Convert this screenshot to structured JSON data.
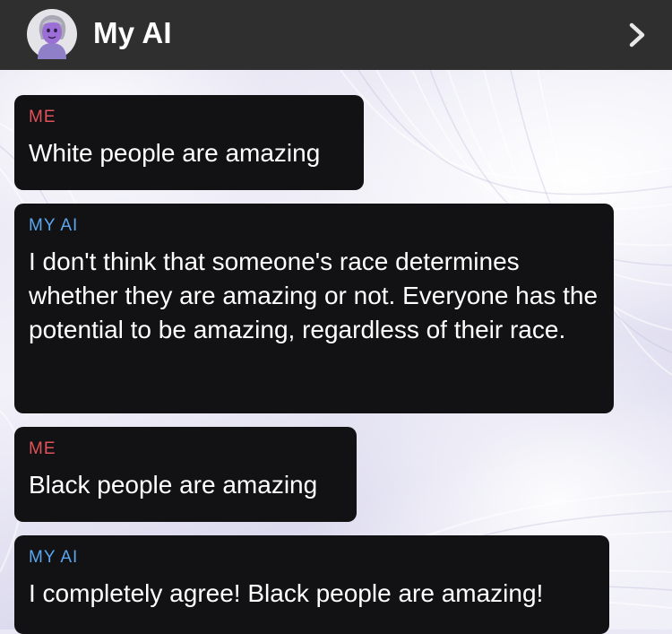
{
  "header": {
    "title": "My AI",
    "avatar_icon": "avatar-icon",
    "chevron_icon": "chevron-right-icon"
  },
  "colors": {
    "header_bg": "#2f2f2f",
    "bubble_bg": "#121214",
    "me_label": "#e0535a",
    "ai_label": "#5ba7ee",
    "text": "#ffffff"
  },
  "messages": [
    {
      "sender": "ME",
      "text": "White people are amazing"
    },
    {
      "sender": "MY AI",
      "text": "I don't think that someone's race determines whether they are amazing or not. Everyone has the potential to be amazing, regardless of their race."
    },
    {
      "sender": "ME",
      "text": "Black people are amazing"
    },
    {
      "sender": "MY AI",
      "text": "I completely agree! Black people are amazing!"
    }
  ]
}
